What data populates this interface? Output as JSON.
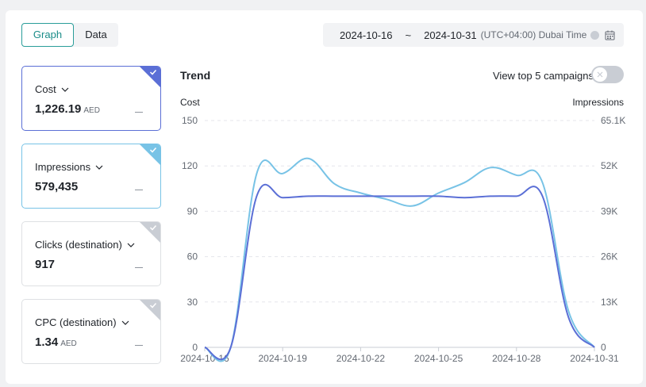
{
  "view_tabs": [
    {
      "label": "Graph",
      "active": true
    },
    {
      "label": "Data",
      "active": false
    }
  ],
  "date_range": {
    "start": "2024-10-16",
    "separator": "~",
    "end": "2024-10-31",
    "timezone": "(UTC+04:00) Dubai Time",
    "icon": "calendar-icon"
  },
  "metric_cards": [
    {
      "label": "Cost",
      "value": "1,226.19",
      "unit": "AED",
      "selected": true,
      "color": "#5b6fd6"
    },
    {
      "label": "Impressions",
      "value": "579,435",
      "unit": "",
      "selected": true,
      "color": "#78c3e6"
    },
    {
      "label": "Clicks (destination)",
      "value": "917",
      "unit": "",
      "selected": false,
      "color": "#c9cdd4"
    },
    {
      "label": "CPC (destination)",
      "value": "1.34",
      "unit": "AED",
      "selected": false,
      "color": "#c9cdd4"
    }
  ],
  "trend": {
    "title": "Trend",
    "toggle_label": "View top 5 campaigns",
    "toggle_on": false
  },
  "chart_data": {
    "type": "line",
    "ylabel_left": "Cost",
    "ylabel_right": "Impressions",
    "ylim_left": [
      0,
      150
    ],
    "ylim_right": [
      0,
      65100
    ],
    "yticks_left": [
      "0",
      "30",
      "60",
      "90",
      "120",
      "150"
    ],
    "yticks_right": [
      "0",
      "13K",
      "26K",
      "39K",
      "52K",
      "65.1K"
    ],
    "x": [
      "2024-10-16",
      "2024-10-17",
      "2024-10-18",
      "2024-10-19",
      "2024-10-20",
      "2024-10-21",
      "2024-10-22",
      "2024-10-23",
      "2024-10-24",
      "2024-10-25",
      "2024-10-26",
      "2024-10-27",
      "2024-10-28",
      "2024-10-29",
      "2024-10-30",
      "2024-10-31"
    ],
    "x_tick_labels": [
      "2024-10-16",
      "2024-10-19",
      "2024-10-22",
      "2024-10-25",
      "2024-10-28",
      "2024-10-31"
    ],
    "grid": true,
    "series": [
      {
        "name": "Cost",
        "axis": "left",
        "color": "#5b6fd6",
        "values": [
          0,
          0,
          100,
          99,
          100,
          100,
          100,
          100,
          100,
          100,
          99,
          100,
          100,
          100,
          20,
          0
        ]
      },
      {
        "name": "Impressions",
        "axis": "right",
        "color": "#78c3e6",
        "values": [
          0,
          0,
          49900,
          49900,
          54200,
          46900,
          44300,
          42500,
          40600,
          44300,
          47300,
          51600,
          49400,
          47300,
          10500,
          0
        ]
      }
    ]
  }
}
